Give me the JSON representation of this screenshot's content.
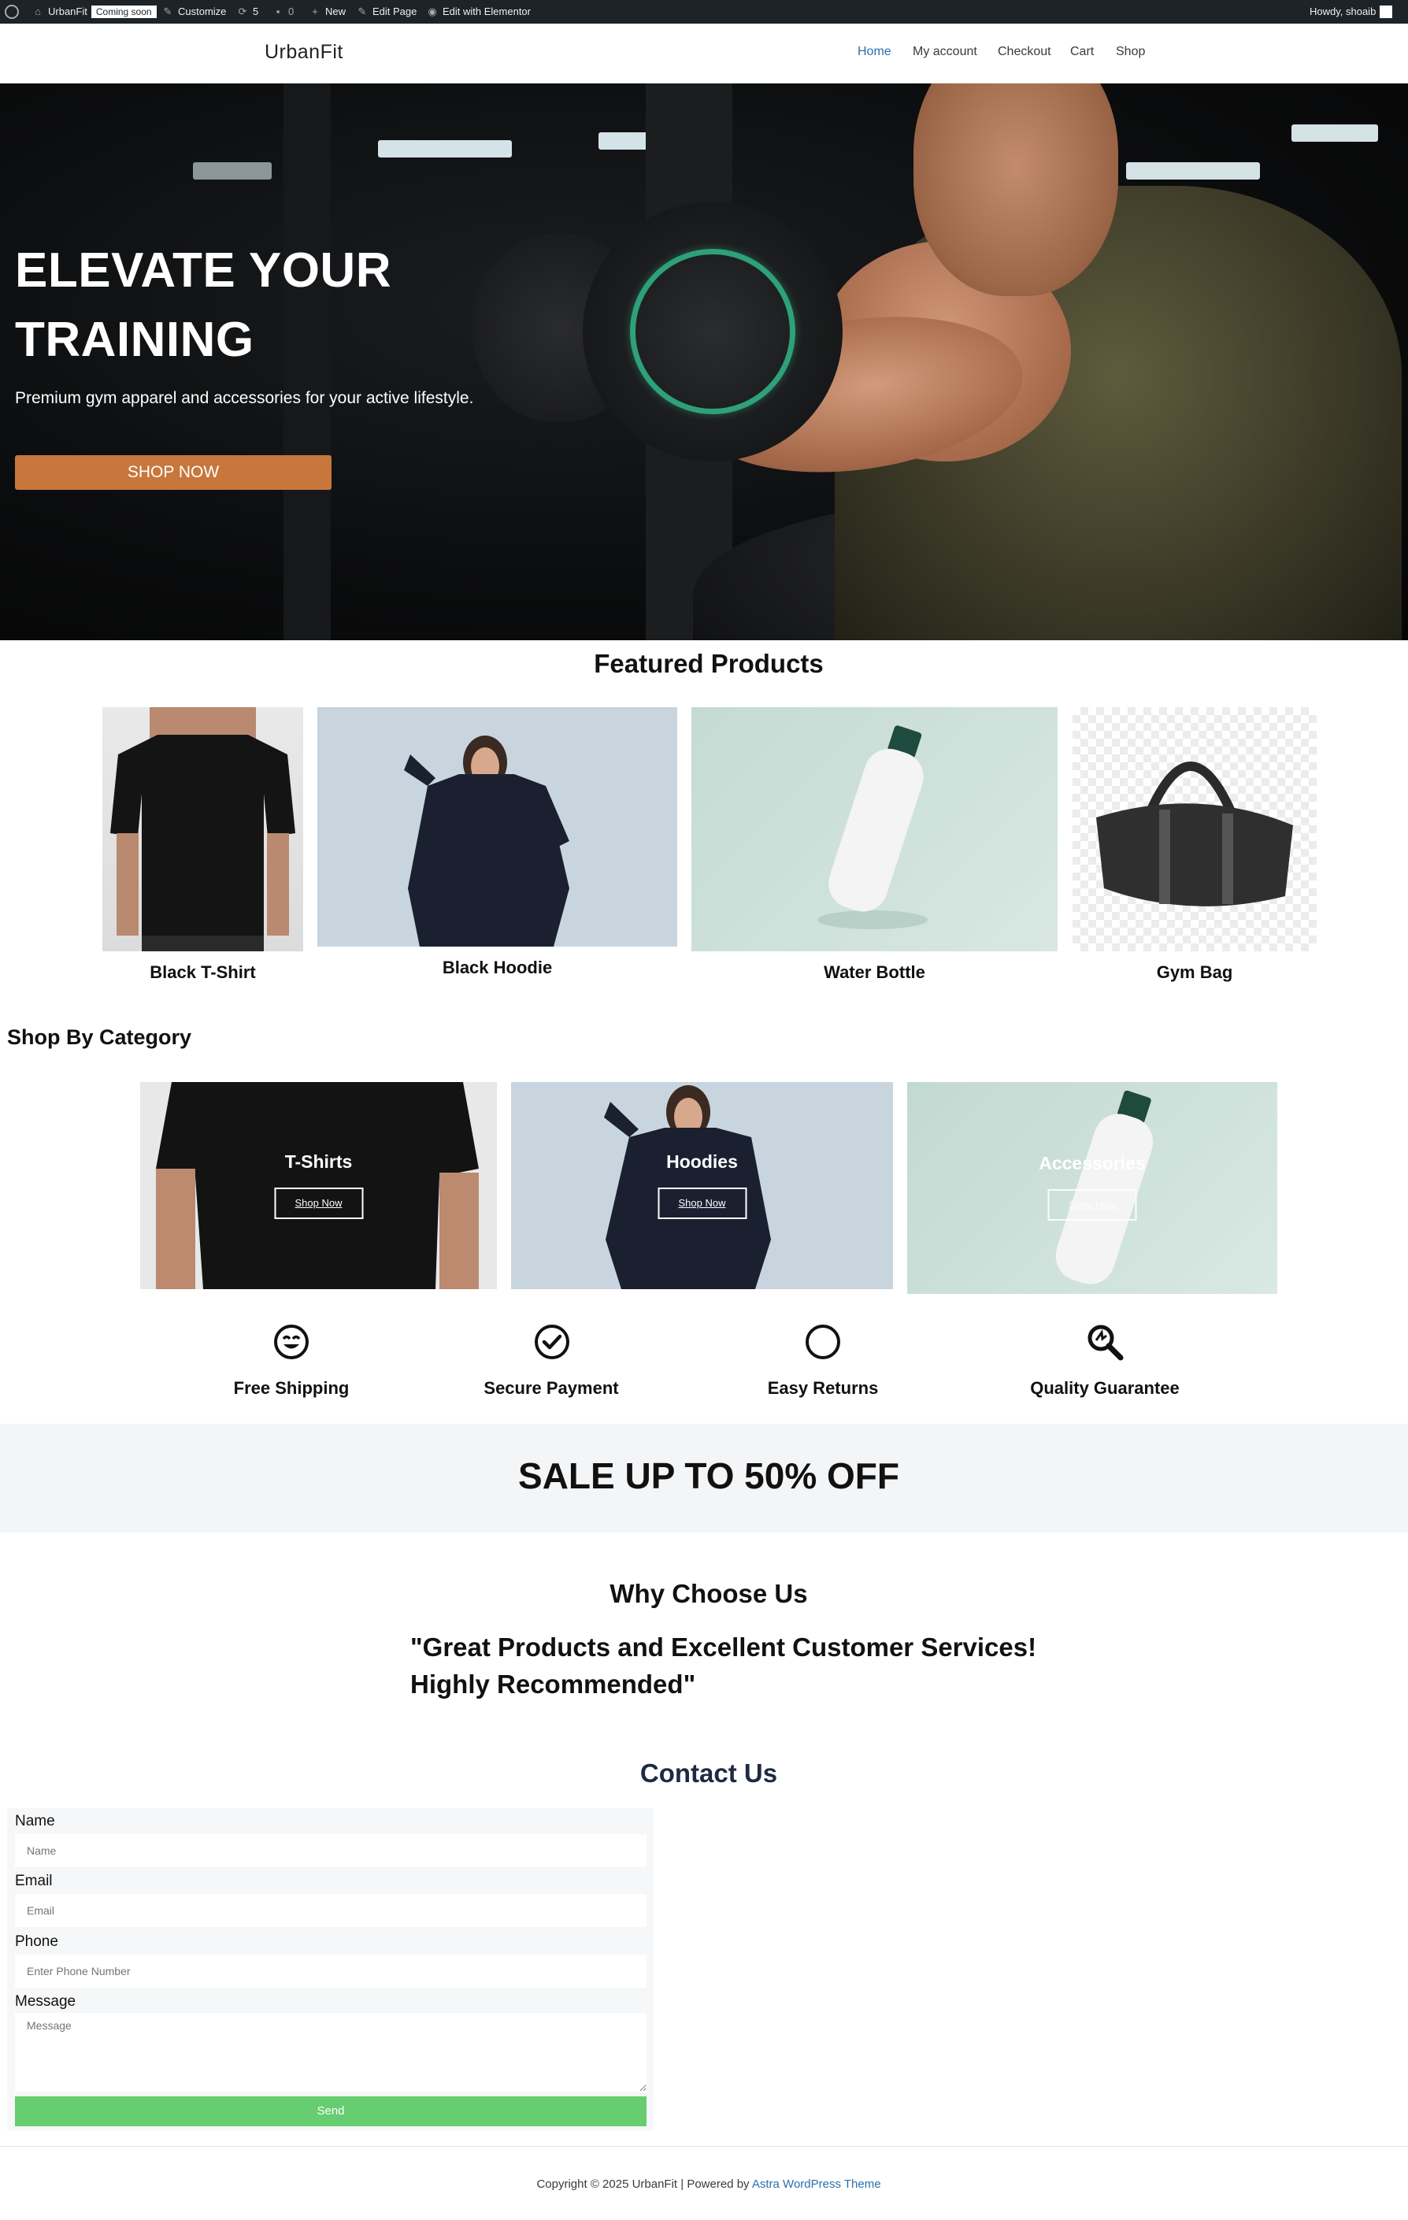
{
  "adminbar": {
    "site_name": "UrbanFit",
    "coming_soon": "Coming soon",
    "customize": "Customize",
    "updates_count": "5",
    "comments_count": "0",
    "new": "New",
    "edit_page": "Edit Page",
    "edit_elementor": "Edit with Elementor",
    "howdy": "Howdy, shoaib"
  },
  "header": {
    "logo": "UrbanFit",
    "nav": [
      "Home",
      "My account",
      "Checkout",
      "Cart",
      "Shop"
    ]
  },
  "hero": {
    "title_line1": "ELEVATE YOUR",
    "title_line2": "TRAINING",
    "subtitle": "Premium gym apparel and accessories for your active lifestyle.",
    "button": "SHOP NOW"
  },
  "featured": {
    "title": "Featured Products",
    "products": [
      {
        "name": "Black T-Shirt"
      },
      {
        "name": "Black Hoodie"
      },
      {
        "name": "Water Bottle"
      },
      {
        "name": "Gym Bag"
      }
    ]
  },
  "categories": {
    "title": "Shop By Category",
    "items": [
      {
        "name": "T-Shirts",
        "button": "Shop Now"
      },
      {
        "name": "Hoodies",
        "button": "Shop Now"
      },
      {
        "name": "Accessories",
        "button": "Shop Now"
      }
    ]
  },
  "features": [
    {
      "label": "Free Shipping",
      "icon": "smiley-icon"
    },
    {
      "label": "Secure Payment",
      "icon": "check-circle-icon"
    },
    {
      "label": "Easy Returns",
      "icon": "circle-icon"
    },
    {
      "label": "Quality Guarantee",
      "icon": "magnifier-icon"
    }
  ],
  "sale": {
    "text": "SALE UP TO 50% OFF"
  },
  "why": {
    "title": "Why Choose Us",
    "quote_line1": "\"Great Products and Excellent Customer Services!",
    "quote_line2": "Highly Recommended\""
  },
  "contact": {
    "title": "Contact Us",
    "fields": {
      "name_label": "Name",
      "name_placeholder": "Name",
      "email_label": "Email",
      "email_placeholder": "Email",
      "phone_label": "Phone",
      "phone_placeholder": "Enter Phone Number",
      "message_label": "Message",
      "message_placeholder": "Message"
    },
    "send": "Send"
  },
  "footer": {
    "text": "Copyright © 2025 UrbanFit | Powered by ",
    "link": "Astra WordPress Theme"
  },
  "colors": {
    "accent_button": "#c7773b",
    "nav_active": "#2a6fb0",
    "send_button": "#66cd70",
    "admin_bar": "#1d2327"
  }
}
